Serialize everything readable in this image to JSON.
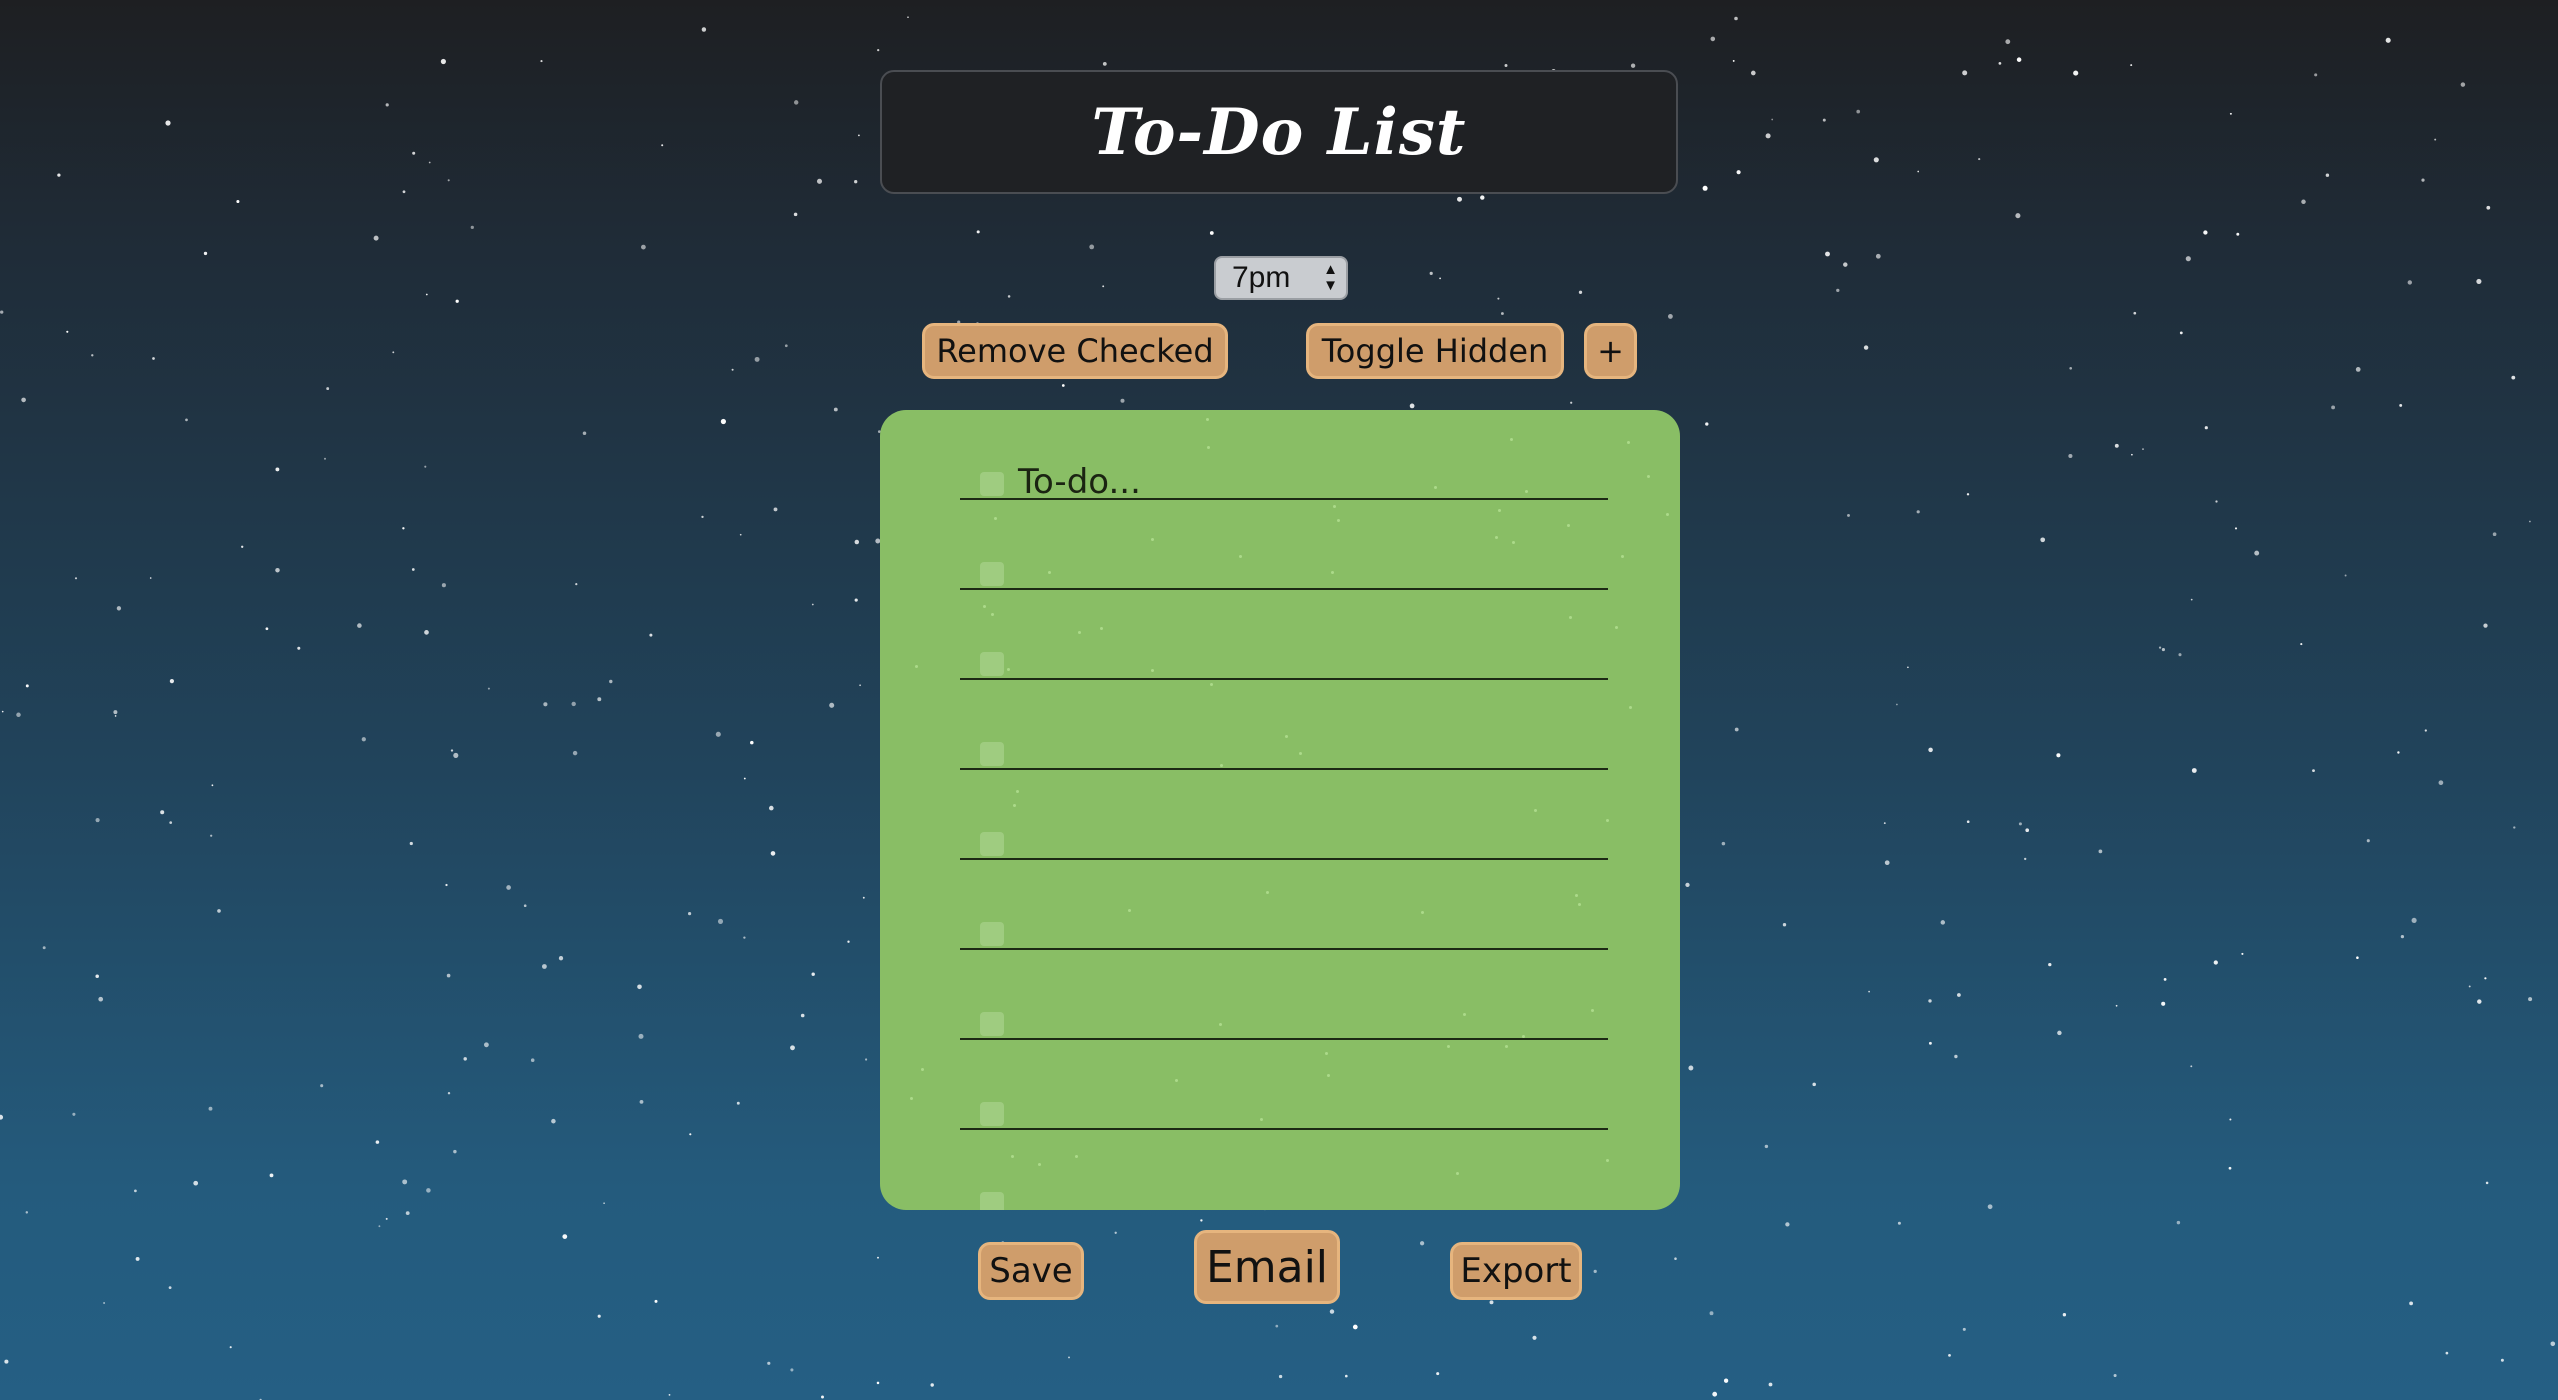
{
  "app": {
    "title": "To-Do List"
  },
  "time_select": {
    "selected": "7pm",
    "arrow_up": "▲",
    "arrow_down": "▼"
  },
  "toolbar": {
    "remove_checked_label": "Remove Checked",
    "toggle_hidden_label": "Toggle Hidden",
    "add_label": "+"
  },
  "todo_list": {
    "items": [
      {
        "text": "To-do...",
        "checked": false
      },
      {
        "text": "",
        "checked": false
      },
      {
        "text": "",
        "checked": false
      },
      {
        "text": "",
        "checked": false
      },
      {
        "text": "",
        "checked": false
      },
      {
        "text": "",
        "checked": false
      },
      {
        "text": "",
        "checked": false
      },
      {
        "text": "",
        "checked": false
      },
      {
        "text": "",
        "checked": false
      }
    ]
  },
  "footer": {
    "save_label": "Save",
    "email_label": "Email",
    "export_label": "Export"
  },
  "colors": {
    "background_top": "#1e1f22",
    "background_bottom": "#255f84",
    "list_card": "#89be65",
    "button": "#cf9d6b",
    "button_border": "#e6b57e"
  }
}
